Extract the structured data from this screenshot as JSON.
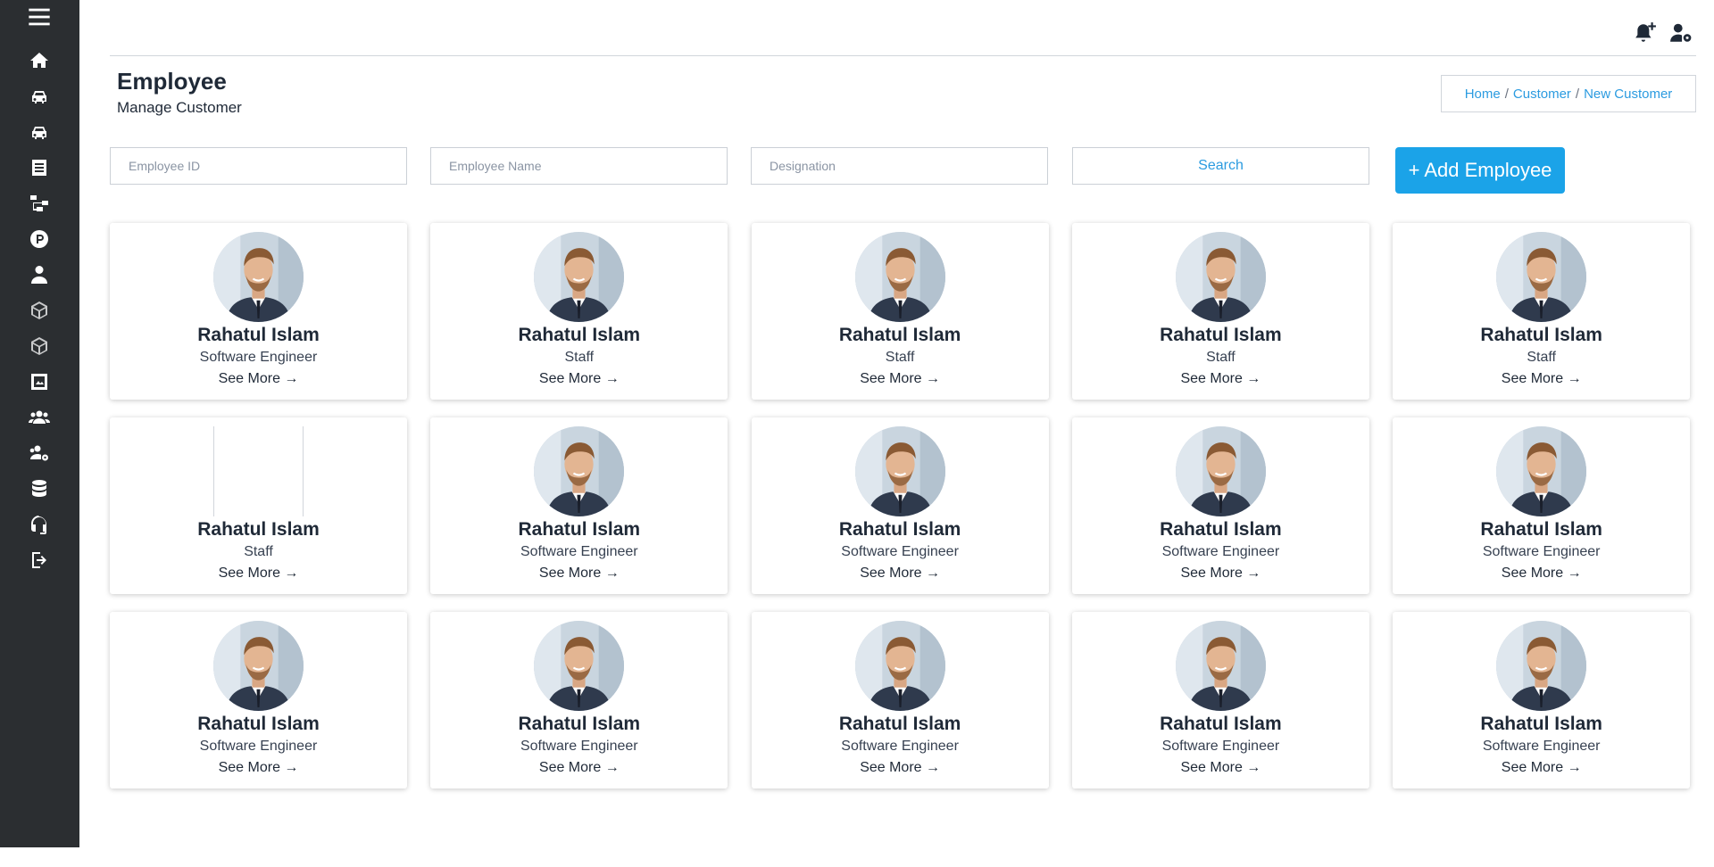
{
  "sidebar": {
    "items": [
      {
        "icon": "menu-icon"
      },
      {
        "icon": "home-icon"
      },
      {
        "icon": "car-icon"
      },
      {
        "icon": "car-icon"
      },
      {
        "icon": "document-icon"
      },
      {
        "icon": "network-icon"
      },
      {
        "icon": "parking-icon"
      },
      {
        "icon": "user-tie-icon"
      },
      {
        "icon": "cube-icon"
      },
      {
        "icon": "cube-icon"
      },
      {
        "icon": "image-icon"
      },
      {
        "icon": "users-icon"
      },
      {
        "icon": "users-gear-icon"
      },
      {
        "icon": "database-icon"
      },
      {
        "icon": "headset-icon"
      },
      {
        "icon": "logout-icon"
      }
    ]
  },
  "topbar": {
    "icons": [
      "bell-plus-icon",
      "user-gear-icon"
    ]
  },
  "header": {
    "title": "Employee",
    "subtitle": "Manage Customer",
    "breadcrumb": {
      "home": "Home",
      "sep1": "/",
      "section": "Customer",
      "sep2": "/",
      "current": "New Customer"
    }
  },
  "filters": {
    "employee_id_placeholder": "Employee ID",
    "employee_name_placeholder": "Employee Name",
    "designation_placeholder": "Designation",
    "search_label": "Search",
    "add_label": "+ Add Employee"
  },
  "employees": [
    {
      "name": "Rahatul Islam",
      "role": "Software Engineer",
      "more": "See More →",
      "photo": true
    },
    {
      "name": "Rahatul Islam",
      "role": "Staff",
      "more": "See More →",
      "photo": true
    },
    {
      "name": "Rahatul Islam",
      "role": "Staff",
      "more": "See More →",
      "photo": true
    },
    {
      "name": "Rahatul Islam",
      "role": "Staff",
      "more": "See More →",
      "photo": true
    },
    {
      "name": "Rahatul Islam",
      "role": "Staff",
      "more": "See More →",
      "photo": true
    },
    {
      "name": "Rahatul Islam",
      "role": "Staff",
      "more": "See More →",
      "photo": false
    },
    {
      "name": "Rahatul Islam",
      "role": "Software Engineer",
      "more": "See More →",
      "photo": true
    },
    {
      "name": "Rahatul Islam",
      "role": "Software Engineer",
      "more": "See More →",
      "photo": true
    },
    {
      "name": "Rahatul Islam",
      "role": "Software Engineer",
      "more": "See More →",
      "photo": true
    },
    {
      "name": "Rahatul Islam",
      "role": "Software Engineer",
      "more": "See More →",
      "photo": true
    },
    {
      "name": "Rahatul Islam",
      "role": "Software Engineer",
      "more": "See More →",
      "photo": true
    },
    {
      "name": "Rahatul Islam",
      "role": "Software Engineer",
      "more": "See More →",
      "photo": true
    },
    {
      "name": "Rahatul Islam",
      "role": "Software Engineer",
      "more": "See More →",
      "photo": true
    },
    {
      "name": "Rahatul Islam",
      "role": "Software Engineer",
      "more": "See More →",
      "photo": true
    },
    {
      "name": "Rahatul Islam",
      "role": "Software Engineer",
      "more": "See More →",
      "photo": true
    }
  ],
  "colors": {
    "sidebar": "#2b2e31",
    "accent": "#1ba3e8",
    "link": "#2b9be0"
  }
}
